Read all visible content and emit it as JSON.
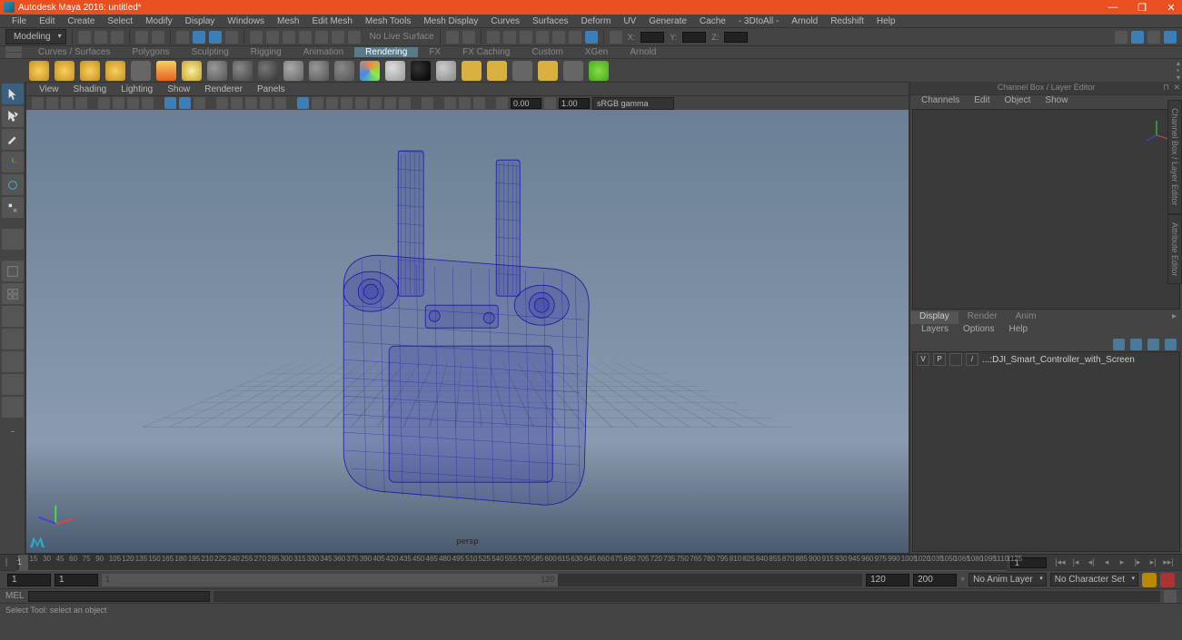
{
  "title": "Autodesk Maya 2016: untitled*",
  "menus": [
    "File",
    "Edit",
    "Create",
    "Select",
    "Modify",
    "Display",
    "Windows",
    "Mesh",
    "Edit Mesh",
    "Mesh Tools",
    "Mesh Display",
    "Curves",
    "Surfaces",
    "Deform",
    "UV",
    "Generate",
    "Cache",
    "- 3DtoAll -",
    "Arnold",
    "Redshift",
    "Help"
  ],
  "workspace": "Modeling",
  "no_live": "No Live Surface",
  "xyz": {
    "x": "X:",
    "y": "Y:",
    "z": "Z:"
  },
  "shelf_tabs": [
    "Curves / Surfaces",
    "Polygons",
    "Sculpting",
    "Rigging",
    "Animation",
    "Rendering",
    "FX",
    "FX Caching",
    "Custom",
    "XGen",
    "Arnold"
  ],
  "shelf_active": "Rendering",
  "viewport": {
    "menus": [
      "View",
      "Shading",
      "Lighting",
      "Show",
      "Renderer",
      "Panels"
    ],
    "exposure": "0.00",
    "gamma": "1.00",
    "colorspace": "sRGB gamma",
    "label": "persp"
  },
  "channel_box": {
    "title": "Channel Box / Layer Editor",
    "menus": [
      "Channels",
      "Edit",
      "Object",
      "Show"
    ]
  },
  "layers": {
    "tabs": [
      "Display",
      "Render",
      "Anim"
    ],
    "active": "Display",
    "menus": [
      "Layers",
      "Options",
      "Help"
    ],
    "row": {
      "v": "V",
      "p": "P",
      "slash": "/",
      "name": "...:DJI_Smart_Controller_with_Screen"
    }
  },
  "side_tabs": [
    "Channel Box / Layer Editor",
    "Attribute Editor"
  ],
  "timeline": {
    "ticks": [
      "1",
      "15",
      "30",
      "45",
      "60",
      "75",
      "90",
      "105",
      "120",
      "135",
      "150",
      "165",
      "180",
      "195",
      "210",
      "225",
      "240",
      "255",
      "270",
      "285",
      "300",
      "315",
      "330",
      "345",
      "360",
      "375",
      "390",
      "405",
      "420",
      "435",
      "450",
      "465",
      "480",
      "495",
      "510",
      "525",
      "540",
      "555",
      "570",
      "585",
      "600",
      "615",
      "630",
      "645",
      "660",
      "675",
      "690",
      "705",
      "720",
      "735",
      "750",
      "765",
      "780",
      "795",
      "810",
      "825",
      "840",
      "855",
      "870",
      "885",
      "900",
      "915",
      "930",
      "945",
      "960",
      "975",
      "990",
      "1005",
      "1020",
      "1035",
      "1050",
      "1065",
      "1080",
      "1095",
      "1110",
      "1125"
    ],
    "marker": "1",
    "end": "1"
  },
  "range": {
    "start": "1",
    "in": "1",
    "h_start": "1",
    "h_end": "120",
    "out": "120",
    "end": "200",
    "anim_layer": "No Anim Layer",
    "char_set": "No Character Set"
  },
  "cmd": {
    "label": "MEL"
  },
  "help": "Select Tool: select an object"
}
